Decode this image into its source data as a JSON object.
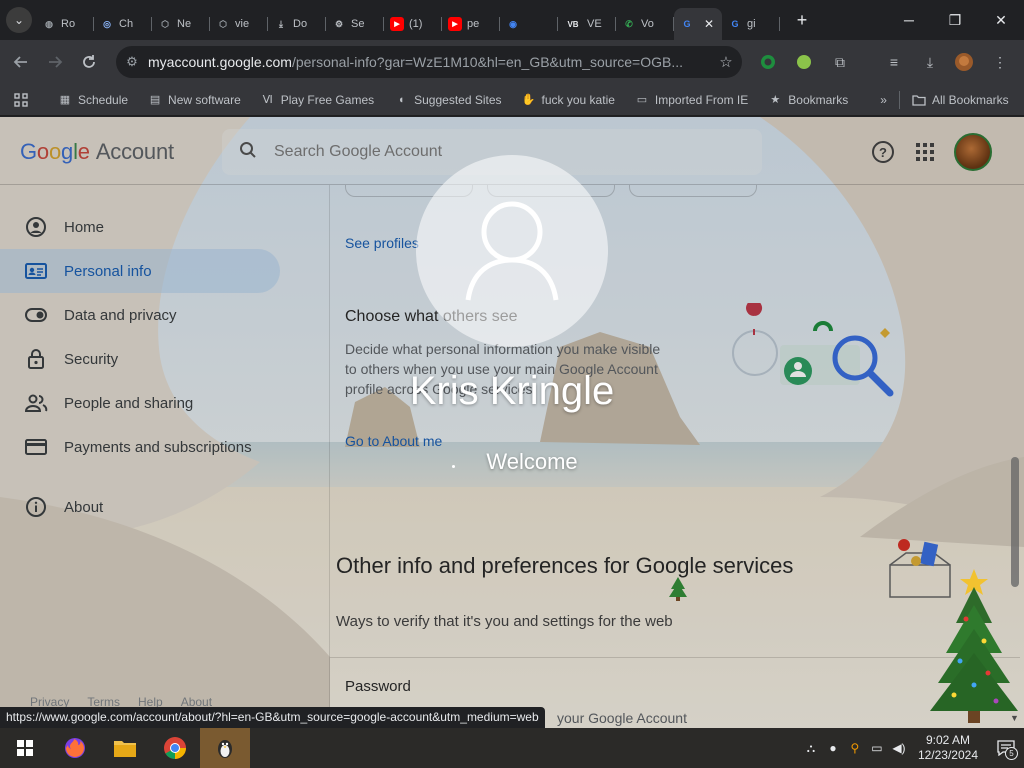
{
  "browser": {
    "tabs": [
      {
        "label": "Ro",
        "icon": "globe-icon",
        "color": "#9aa0a6"
      },
      {
        "label": "Ch",
        "icon": "lens-icon",
        "color": "#8ab4f8"
      },
      {
        "label": "Ne",
        "icon": "shield-icon",
        "color": "#9aa0a6"
      },
      {
        "label": "vie",
        "icon": "shield-icon",
        "color": "#9aa0a6"
      },
      {
        "label": "Do",
        "icon": "download-icon",
        "color": "#bdc1c6"
      },
      {
        "label": "Se",
        "icon": "gear-icon",
        "color": "#bdc1c6"
      },
      {
        "label": "(1)",
        "icon": "youtube-icon",
        "color": "#ff0000"
      },
      {
        "label": "pe",
        "icon": "youtube-icon",
        "color": "#ff0000"
      },
      {
        "label": "",
        "icon": "chrome-icon",
        "color": "#4285f4"
      },
      {
        "label": "VE",
        "icon": "vb-icon",
        "color": "#e8eaed"
      },
      {
        "label": "Vo",
        "icon": "phone-icon",
        "color": "#34a853"
      },
      {
        "label": "",
        "icon": "google-icon",
        "color": "#4285f4",
        "active": true
      },
      {
        "label": "gi",
        "icon": "google-icon",
        "color": "#4285f4"
      }
    ],
    "window_controls": {
      "minimize": "─",
      "restore": "❐",
      "close": "✕"
    },
    "url_host": "myaccount.google.com",
    "url_rest": "/personal-info?gar=WzE1M10&hl=en_GB&utm_source=OGB...",
    "bookmarks": [
      {
        "label": "Schedule",
        "icon": "schedule-icon"
      },
      {
        "label": "New software",
        "icon": "software-icon"
      },
      {
        "label": "Play Free Games",
        "icon": "games-icon"
      },
      {
        "label": "Suggested Sites",
        "icon": "suggested-icon"
      },
      {
        "label": "fuck you katie",
        "icon": "hand-icon"
      },
      {
        "label": "Imported From IE",
        "icon": "folder-icon"
      },
      {
        "label": "Bookmarks",
        "icon": "star-icon"
      }
    ],
    "more_bookmarks": "»",
    "all_bookmarks": "All Bookmarks",
    "status_url": "https://www.google.com/account/about/?hl=en-GB&utm_source=google-account&utm_medium=web"
  },
  "account": {
    "logo": {
      "g1": "G",
      "g2": "o",
      "g3": "o",
      "g4": "g",
      "g5": "l",
      "g6": "e",
      "product": "Account"
    },
    "search_placeholder": "Search Google Account",
    "nav": [
      {
        "label": "Home",
        "icon": "home-icon"
      },
      {
        "label": "Personal info",
        "icon": "id-card-icon",
        "active": true
      },
      {
        "label": "Data and privacy",
        "icon": "toggle-icon"
      },
      {
        "label": "Security",
        "icon": "lock-icon"
      },
      {
        "label": "People and sharing",
        "icon": "people-icon"
      },
      {
        "label": "Payments and subscriptions",
        "icon": "card-icon"
      },
      {
        "label": "About",
        "icon": "info-icon"
      }
    ],
    "footer": [
      "Privacy",
      "Terms",
      "Help",
      "About"
    ],
    "see_profiles": "See profiles",
    "choose_title": "Choose what others see",
    "choose_desc": "Decide what personal information you make visible to others when you use your main Google Account profile across Google services",
    "about_link": "Go to About me",
    "other_title": "Other info and preferences for Google services",
    "other_desc": "Ways to verify that it's you and settings for the web",
    "password_title": "Password",
    "password_desc": "your Google Account"
  },
  "lockscreen": {
    "user_name": "Kris Kringle",
    "status": "Welcome"
  },
  "taskbar": {
    "apps": [
      {
        "name": "start",
        "icon": "windows-icon"
      },
      {
        "name": "firefox",
        "icon": "firefox-icon"
      },
      {
        "name": "explorer",
        "icon": "folder-icon"
      },
      {
        "name": "chrome",
        "icon": "chrome-icon"
      },
      {
        "name": "app",
        "icon": "penguin-icon",
        "active": true
      }
    ],
    "time": "9:02 AM",
    "date": "12/23/2024",
    "notification_count": "5"
  }
}
